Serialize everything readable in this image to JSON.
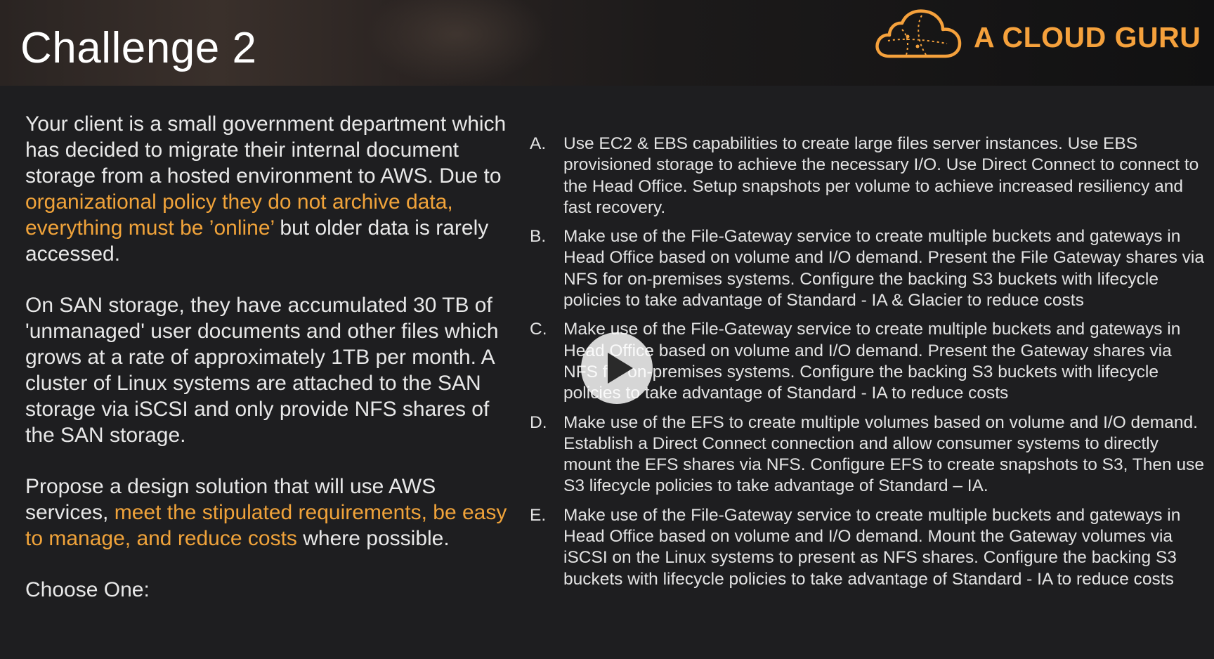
{
  "slide": {
    "title": "Challenge 2",
    "brand": {
      "name": "A CLOUD GURU",
      "color": "#f5a13c",
      "icon": "cloud-icon"
    },
    "highlight_color": "#f0a33a"
  },
  "scenario": {
    "p1_a": "Your client is a small government department which has decided to migrate their internal document storage from a hosted environment to AWS.  Due to ",
    "p1_hl": "organizational policy they do not archive data, everything must be ’online’",
    "p1_b": " but older data is rarely accessed.",
    "p2": "On SAN storage, they have accumulated 30 TB of 'unmanaged' user documents and other files which grows at a rate of approximately 1TB  per month.  A cluster of Linux systems are attached to the SAN storage via iSCSI and only provide NFS shares of the SAN storage.",
    "p3_a": "Propose a design solution that will use AWS services, ",
    "p3_hl": "meet the stipulated requirements, be easy to manage, and reduce costs",
    "p3_b": " where possible.",
    "prompt": "Choose One:"
  },
  "options": [
    {
      "letter": "A.",
      "text": "Use EC2 & EBS capabilities to create large files server instances. Use EBS provisioned storage to achieve the necessary I/O.  Use Direct Connect to connect to the Head Office.   Setup snapshots per volume to achieve increased resiliency and fast recovery."
    },
    {
      "letter": "B.",
      "text": "Make use of the File-Gateway service to create multiple buckets and gateways in Head Office based on volume and I/O demand.   Present the File Gateway shares via NFS for on-premises systems.  Configure the backing S3 buckets with lifecycle policies to take advantage of  Standard - IA & Glacier to reduce costs"
    },
    {
      "letter": "C.",
      "text": "Make use of the File-Gateway service to create multiple buckets and gateways in Head Office based on volume and I/O demand. Present the Gateway shares via NFS for on-premises systems.  Configure the backing S3 buckets with lifecycle policies to take advantage of  Standard - IA to reduce costs"
    },
    {
      "letter": "D.",
      "text": "Make use of the EFS to create multiple volumes based on volume and I/O demand. Establish a Direct Connect connection and allow consumer systems to directly mount the EFS shares via NFS.  Configure EFS to create snapshots to S3, Then use S3 lifecycle  policies to take advantage of  Standard – IA."
    },
    {
      "letter": "E.",
      "text": "Make use of the File-Gateway service to create multiple buckets and gateways in Head Office based on volume and I/O demand. Mount the Gateway volumes via iSCSI on the Linux systems to present as NFS shares.  Configure the backing S3 buckets with lifecycle policies to take advantage of  Standard - IA to reduce costs"
    }
  ],
  "player": {
    "control": "play-icon"
  }
}
